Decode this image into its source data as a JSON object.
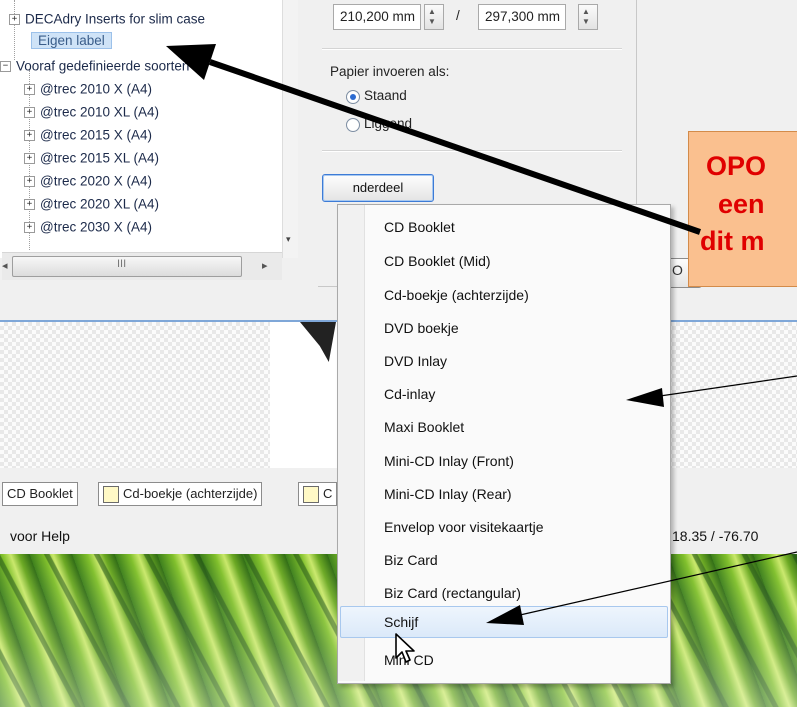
{
  "tree": {
    "items": [
      {
        "expander": "+",
        "label": "DECAdry Inserts for slim case"
      },
      {
        "expander": "",
        "label": "Eigen label"
      },
      {
        "expander": "−",
        "label": "Vooraf gedefinieerde soorten"
      },
      {
        "expander": "+",
        "label": "@trec 2010 X (A4)"
      },
      {
        "expander": "+",
        "label": "@trec 2010 XL (A4)"
      },
      {
        "expander": "+",
        "label": "@trec 2015 X (A4)"
      },
      {
        "expander": "+",
        "label": "@trec 2015 XL (A4)"
      },
      {
        "expander": "+",
        "label": "@trec 2020 X (A4)"
      },
      {
        "expander": "+",
        "label": "@trec 2020 XL (A4)"
      },
      {
        "expander": "+",
        "label": "@trec 2030 X (A4)"
      }
    ],
    "scroll_thumb_grip": "III",
    "scroll_left": "◂",
    "scroll_right": "▸"
  },
  "form": {
    "width_value": "210,200 mm",
    "separator": "/",
    "height_value": "297,300 mm",
    "paper_feed_label": "Papier invoeren als:",
    "portrait_label": "Staand",
    "landscape_label": "Liggend",
    "add_part_button": "nderdeel toevoegen.",
    "ok_button_partial": "O"
  },
  "context_menu": {
    "items": [
      "CD Booklet",
      "CD Booklet (Mid)",
      "Cd-boekje (achterzijde)",
      "DVD boekje",
      "DVD Inlay",
      "Cd-inlay",
      "Maxi Booklet",
      "Mini-CD Inlay (Front)",
      "Mini-CD Inlay (Rear)",
      "Envelop voor visitekaartje",
      "Biz Card",
      "Biz Card (rectangular)",
      "Schijf",
      "Mini CD"
    ],
    "highlighted_item": "Schijf"
  },
  "doc_tabs": {
    "tab1": "CD Booklet",
    "tab2": "Cd-boekje (achterzijde)",
    "tab3_partial": "C"
  },
  "status_bar": {
    "help_text": "voor Help",
    "coordinates": "18.35 / -76.70"
  },
  "callout": {
    "line1": "OPO",
    "line2": "een",
    "line3": "dit m"
  },
  "colors": {
    "callout_fill": "#fac08f",
    "callout_text": "#e00000",
    "selection": "#cfe3f7",
    "button_focus": "#3d7bd6"
  }
}
